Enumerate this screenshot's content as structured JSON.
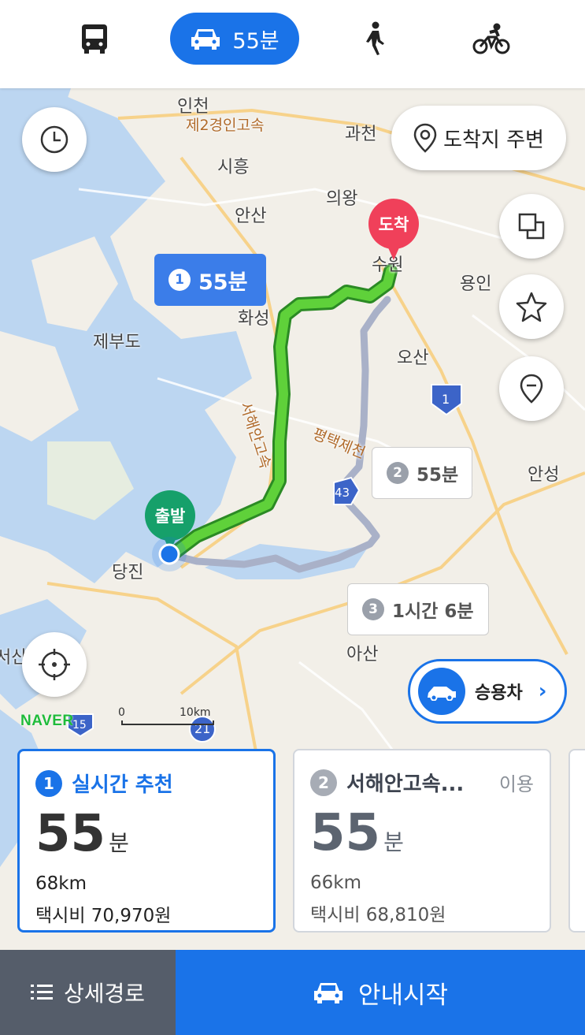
{
  "modes": {
    "bus_icon": "bus-icon",
    "car_icon": "car-icon",
    "car_time": "55분",
    "walk_icon": "walk-icon",
    "bike_icon": "bike-icon",
    "active_color": "#1a73e8"
  },
  "map": {
    "places": {
      "incheon": "인천",
      "gwacheon": "과천",
      "siheung": "시흥",
      "uiwang": "의왕",
      "ansan": "안산",
      "suwon": "수원",
      "yongin": "용인",
      "hwaseong": "화성",
      "jebudo": "제부도",
      "osan": "오산",
      "anseong": "안성",
      "dangjin": "당진",
      "asan": "아산",
      "seosan": "서산",
      "road_2": "제2경인고속",
      "road_seohaean": "서해안고속",
      "road_pyeongtaek": "평택제천",
      "hw_1": "1",
      "hw_43": "43",
      "hw_21": "21",
      "hw_15": "15"
    },
    "dest_nearby_label": "도착지 주변",
    "dest_pin": "도착",
    "start_pin": "출발",
    "route1": {
      "num": "1",
      "time": "55분"
    },
    "route2": {
      "num": "2",
      "time": "55분"
    },
    "route3": {
      "num": "3",
      "time": "1시간 6분"
    },
    "vehicle_label": "승용차",
    "brand": "NAVER",
    "scale_start": "0",
    "scale_end": "10km",
    "route_color": "#3ab52f",
    "alt_route_color": "#a9b1c8"
  },
  "cards": [
    {
      "num": "1",
      "title": "실시간 추천",
      "extra": "",
      "time_value": "55",
      "time_unit": "분",
      "distance": "68km",
      "fare": "택시비 70,970원"
    },
    {
      "num": "2",
      "title": "서해안고속...",
      "extra": "이용",
      "time_value": "55",
      "time_unit": "분",
      "distance": "66km",
      "fare": "택시비 68,810원"
    }
  ],
  "bottom": {
    "detail_label": "상세경로",
    "start_label": "안내시작"
  }
}
